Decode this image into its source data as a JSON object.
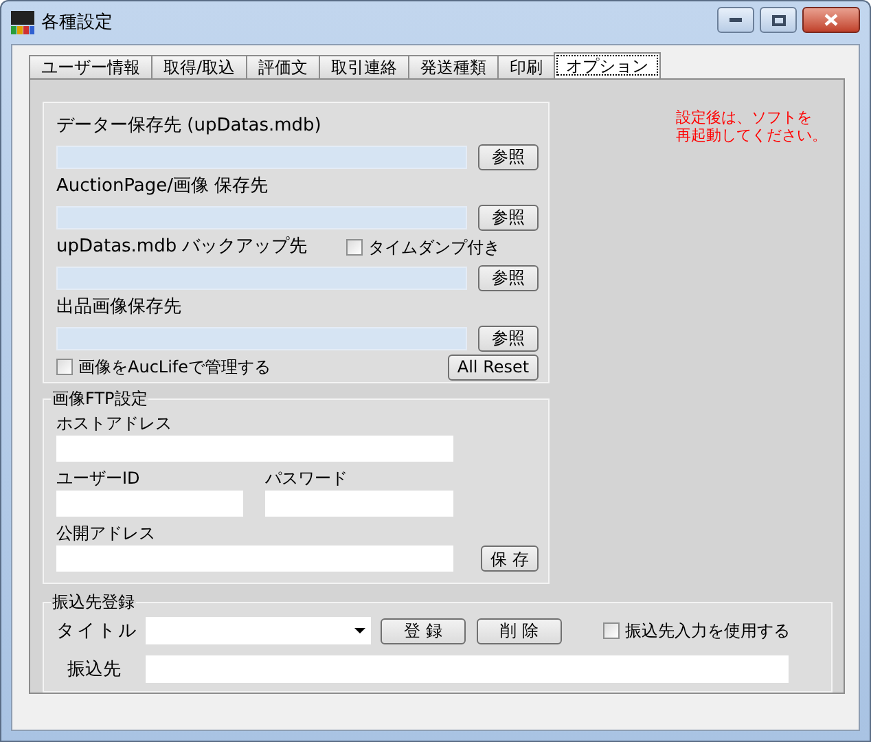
{
  "window": {
    "title": "各種設定"
  },
  "tabs": [
    {
      "label": "ユーザー情報",
      "selected": false
    },
    {
      "label": "取得/取込",
      "selected": false
    },
    {
      "label": "評価文",
      "selected": false
    },
    {
      "label": "取引連絡",
      "selected": false
    },
    {
      "label": "発送種類",
      "selected": false
    },
    {
      "label": "印刷",
      "selected": false
    },
    {
      "label": "オプション",
      "selected": true
    }
  ],
  "storage_group": {
    "rows": [
      {
        "label": "データー保存先 (upDatas.mdb)",
        "button": "参照"
      },
      {
        "label": "AuctionPage/画像 保存先",
        "button": "参照"
      },
      {
        "label": "upDatas.mdb バックアップ先",
        "button": "参照",
        "checkbox": {
          "label": "タイムダンプ付き",
          "checked": false
        }
      },
      {
        "label": "出品画像保存先",
        "button": "参照"
      }
    ],
    "checkbox": {
      "label": "画像をAucLifeで管理する",
      "checked": false
    },
    "reset_button": "All Reset"
  },
  "note": [
    "設定後は、ソフトを",
    "再起動してください。"
  ],
  "ftp_group": {
    "title": "画像FTP設定",
    "host_label": "ホストアドレス",
    "user_label": "ユーザーID",
    "password_label": "パスワード",
    "public_label": "公開アドレス",
    "save_button": "保 存"
  },
  "bank_group": {
    "title": "振込先登録",
    "title_label": "タイトル",
    "buttons": [
      "登 録",
      "削 除"
    ],
    "checkbox": {
      "label": "振込先入力を使用する",
      "checked": false
    },
    "account_label": "振込先"
  }
}
